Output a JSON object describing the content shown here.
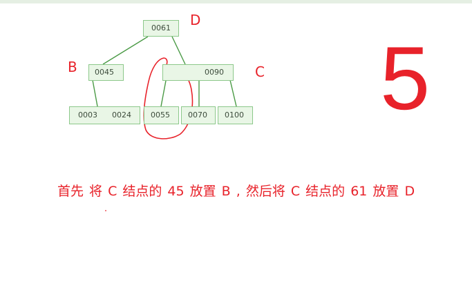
{
  "tree": {
    "root": {
      "keys": [
        "0061"
      ]
    },
    "left": {
      "keys": [
        "0045"
      ]
    },
    "right": {
      "keys": [
        "",
        "0090"
      ]
    },
    "leaves": [
      {
        "keys": [
          "0003",
          "0024"
        ]
      },
      {
        "keys": [
          "0055"
        ]
      },
      {
        "keys": [
          "0070"
        ]
      },
      {
        "keys": [
          "0100"
        ]
      }
    ]
  },
  "labels": {
    "d": "D",
    "b": "B",
    "c": "C"
  },
  "step_number": "5",
  "caption": "首先 将  C 结点的 45  放置 B , 然后将 C 结点的 61 放置 D",
  "colors": {
    "annotation": "#e8222a",
    "node_fill": "#e9f6e6",
    "node_border": "#8cc88a",
    "edge": "#4a9a45"
  }
}
